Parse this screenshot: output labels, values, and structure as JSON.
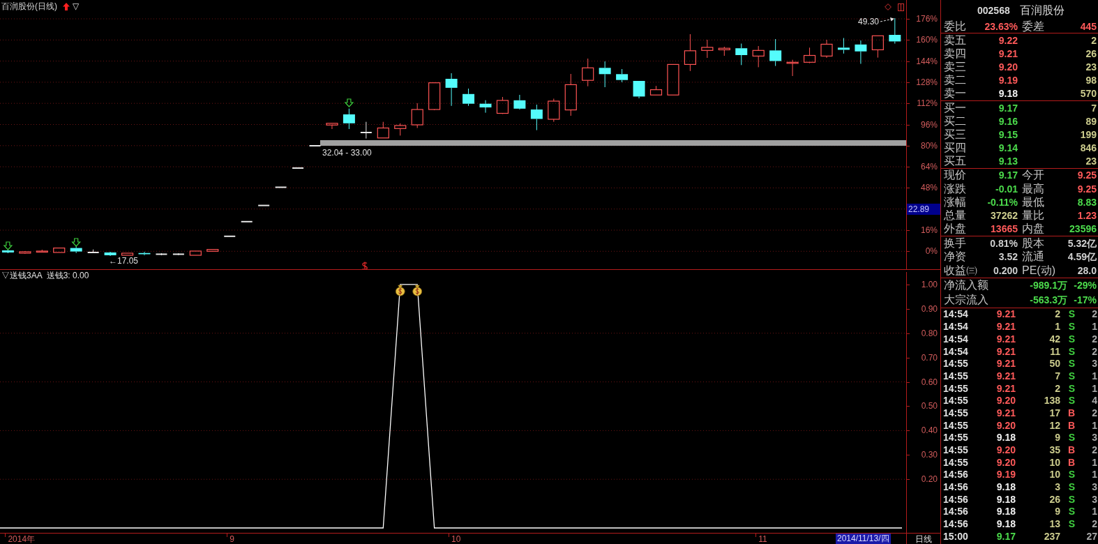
{
  "chart_header": {
    "title": "百润股份(日线)",
    "glyph": "▽"
  },
  "price_chart": {
    "axis": [
      {
        "kind": "tick",
        "label": "176%"
      },
      {
        "kind": "tick",
        "label": "160%"
      },
      {
        "kind": "tick",
        "label": "144%"
      },
      {
        "kind": "tick",
        "label": "128%"
      },
      {
        "kind": "tick",
        "label": "112%"
      },
      {
        "kind": "tick",
        "label": "96%"
      },
      {
        "kind": "tick",
        "label": "80%"
      },
      {
        "kind": "tick",
        "label": "64%"
      },
      {
        "kind": "tick",
        "label": "48%"
      },
      {
        "kind": "cursor",
        "label": "22.89"
      },
      {
        "kind": "tick",
        "label": "16%"
      },
      {
        "kind": "tick",
        "label": "0%"
      }
    ],
    "high_label": "49.30",
    "low_label": "←17.05",
    "band_label": "32.04 - 33.00"
  },
  "indicator": {
    "title": "▽送钱3AA",
    "readout": "送钱3: 0.00",
    "chart_data": {
      "type": "line",
      "ylim": [
        -0.02,
        1.06
      ],
      "grid": true,
      "yticks": [
        {
          "value": 1,
          "label": "1.00"
        },
        {
          "value": 0.9,
          "label": "0.90"
        },
        {
          "value": 0.8,
          "label": "0.80"
        },
        {
          "value": 0.7,
          "label": "0.70"
        },
        {
          "value": 0.6,
          "label": "0.60"
        },
        {
          "value": 0.5,
          "label": "0.50"
        },
        {
          "value": 0.4,
          "label": "0.40"
        },
        {
          "value": 0.3,
          "label": "0.30"
        },
        {
          "value": 0.2,
          "label": "0.20"
        }
      ],
      "series": [
        {
          "color": "#ffffff",
          "values": [
            0,
            0,
            0,
            0,
            0,
            0,
            0,
            0,
            0,
            0,
            0,
            0,
            0,
            0,
            0,
            0,
            0,
            0,
            0,
            0,
            0,
            0,
            0,
            1,
            1,
            0,
            0,
            0,
            0,
            0,
            0,
            0,
            0,
            0,
            0,
            0,
            0,
            0,
            0,
            0,
            0,
            0,
            0,
            0,
            0,
            0,
            0,
            0,
            0,
            0,
            0,
            0,
            0
          ]
        }
      ]
    }
  },
  "time_axis": {
    "labels": [
      "2014年",
      "9",
      "10",
      "11"
    ],
    "cursor_date": "2014/11/13/四",
    "period": "日线"
  },
  "quote_panel": {
    "code": "002568",
    "name": "百润股份",
    "ratio": {
      "label": "委比",
      "value": "23.63%",
      "diff_label": "委差",
      "diff_value": "445"
    },
    "asks": [
      {
        "label": "卖五",
        "price": "9.22",
        "color": "#ff5a5a",
        "volume": "2"
      },
      {
        "label": "卖四",
        "price": "9.21",
        "color": "#ff5a5a",
        "volume": "26"
      },
      {
        "label": "卖三",
        "price": "9.20",
        "color": "#ff5a5a",
        "volume": "23"
      },
      {
        "label": "卖二",
        "price": "9.19",
        "color": "#ff5a5a",
        "volume": "98"
      },
      {
        "label": "卖一",
        "price": "9.18",
        "color": "#f2f2f2",
        "volume": "570"
      }
    ],
    "bids": [
      {
        "label": "买一",
        "price": "9.17",
        "color": "#4cdc4c",
        "volume": "7"
      },
      {
        "label": "买二",
        "price": "9.16",
        "color": "#4cdc4c",
        "volume": "89"
      },
      {
        "label": "买三",
        "price": "9.15",
        "color": "#4cdc4c",
        "volume": "199"
      },
      {
        "label": "买四",
        "price": "9.14",
        "color": "#4cdc4c",
        "volume": "846"
      },
      {
        "label": "买五",
        "price": "9.13",
        "color": "#4cdc4c",
        "volume": "23"
      }
    ],
    "stats": [
      {
        "left": {
          "label": "现价",
          "value": "9.17",
          "color": "#4cdc4c"
        },
        "right": {
          "label": "今开",
          "value": "9.25",
          "color": "#ff5a5a"
        }
      },
      {
        "left": {
          "label": "涨跌",
          "value": "-0.01",
          "color": "#4cdc4c"
        },
        "right": {
          "label": "最高",
          "value": "9.25",
          "color": "#ff5a5a"
        }
      },
      {
        "left": {
          "label": "涨幅",
          "value": "-0.11%",
          "color": "#4cdc4c"
        },
        "right": {
          "label": "最低",
          "value": "8.83",
          "color": "#4cdc4c"
        }
      },
      {
        "left": {
          "label": "总量",
          "value": "37262",
          "color": "#cdcd8e"
        },
        "right": {
          "label": "量比",
          "value": "1.23",
          "color": "#ff5a5a"
        }
      },
      {
        "left": {
          "label": "外盘",
          "value": "13665",
          "color": "#ff5a5a"
        },
        "right": {
          "label": "内盘",
          "value": "23596",
          "color": "#4cdc4c"
        }
      }
    ],
    "fundamentals": [
      {
        "left": {
          "label": "换手",
          "value": "0.81%"
        },
        "right": {
          "label": "股本",
          "value": "5.32亿"
        }
      },
      {
        "left": {
          "label": "净资",
          "value": "3.52"
        },
        "right": {
          "label": "流通",
          "value": "4.59亿"
        }
      },
      {
        "left": {
          "label": "收益㈢",
          "value": "0.200"
        },
        "right": {
          "label": "PE(动)",
          "value": "28.0"
        }
      }
    ],
    "flows": [
      {
        "label": "净流入额",
        "amount": "-989.1万",
        "percent": "-29%"
      },
      {
        "label": "大宗流入",
        "amount": "-563.3万",
        "percent": "-17%"
      }
    ],
    "trades": [
      {
        "time": "14:54",
        "price": {
          "text": "9.21",
          "color": "#ff5a5a"
        },
        "volume": "2",
        "side": {
          "text": "S",
          "color": "#40d040"
        },
        "count": "2"
      },
      {
        "time": "14:54",
        "price": {
          "text": "9.21",
          "color": "#ff5a5a"
        },
        "volume": "1",
        "side": {
          "text": "S",
          "color": "#40d040"
        },
        "count": "1"
      },
      {
        "time": "14:54",
        "price": {
          "text": "9.21",
          "color": "#ff5a5a"
        },
        "volume": "42",
        "side": {
          "text": "S",
          "color": "#40d040"
        },
        "count": "2"
      },
      {
        "time": "14:54",
        "price": {
          "text": "9.21",
          "color": "#ff5a5a"
        },
        "volume": "11",
        "side": {
          "text": "S",
          "color": "#40d040"
        },
        "count": "2"
      },
      {
        "time": "14:55",
        "price": {
          "text": "9.21",
          "color": "#ff5a5a"
        },
        "volume": "50",
        "side": {
          "text": "S",
          "color": "#40d040"
        },
        "count": "3"
      },
      {
        "time": "14:55",
        "price": {
          "text": "9.21",
          "color": "#ff5a5a"
        },
        "volume": "7",
        "side": {
          "text": "S",
          "color": "#40d040"
        },
        "count": "1"
      },
      {
        "time": "14:55",
        "price": {
          "text": "9.21",
          "color": "#ff5a5a"
        },
        "volume": "2",
        "side": {
          "text": "S",
          "color": "#40d040"
        },
        "count": "1"
      },
      {
        "time": "14:55",
        "price": {
          "text": "9.20",
          "color": "#ff5a5a"
        },
        "volume": "138",
        "side": {
          "text": "S",
          "color": "#40d040"
        },
        "count": "4"
      },
      {
        "time": "14:55",
        "price": {
          "text": "9.21",
          "color": "#ff5a5a"
        },
        "volume": "17",
        "side": {
          "text": "B",
          "color": "#ff5a5a"
        },
        "count": "2"
      },
      {
        "time": "14:55",
        "price": {
          "text": "9.20",
          "color": "#ff5a5a"
        },
        "volume": "12",
        "side": {
          "text": "B",
          "color": "#ff5a5a"
        },
        "count": "1"
      },
      {
        "time": "14:55",
        "price": {
          "text": "9.18",
          "color": "#f2f2f2"
        },
        "volume": "9",
        "side": {
          "text": "S",
          "color": "#40d040"
        },
        "count": "3"
      },
      {
        "time": "14:55",
        "price": {
          "text": "9.20",
          "color": "#ff5a5a"
        },
        "volume": "35",
        "side": {
          "text": "B",
          "color": "#ff5a5a"
        },
        "count": "2"
      },
      {
        "time": "14:55",
        "price": {
          "text": "9.20",
          "color": "#ff5a5a"
        },
        "volume": "10",
        "side": {
          "text": "B",
          "color": "#ff5a5a"
        },
        "count": "1"
      },
      {
        "time": "14:56",
        "price": {
          "text": "9.19",
          "color": "#ff5a5a"
        },
        "volume": "10",
        "side": {
          "text": "S",
          "color": "#40d040"
        },
        "count": "1"
      },
      {
        "time": "14:56",
        "price": {
          "text": "9.18",
          "color": "#f2f2f2"
        },
        "volume": "3",
        "side": {
          "text": "S",
          "color": "#40d040"
        },
        "count": "3"
      },
      {
        "time": "14:56",
        "price": {
          "text": "9.18",
          "color": "#f2f2f2"
        },
        "volume": "26",
        "side": {
          "text": "S",
          "color": "#40d040"
        },
        "count": "3"
      },
      {
        "time": "14:56",
        "price": {
          "text": "9.18",
          "color": "#f2f2f2"
        },
        "volume": "9",
        "side": {
          "text": "S",
          "color": "#40d040"
        },
        "count": "1"
      },
      {
        "time": "14:56",
        "price": {
          "text": "9.18",
          "color": "#f2f2f2"
        },
        "volume": "13",
        "side": {
          "text": "S",
          "color": "#40d040"
        },
        "count": "2"
      },
      {
        "time": "15:00",
        "price": {
          "text": "9.17",
          "color": "#4cdc4c"
        },
        "volume": "237",
        "count": "27"
      }
    ]
  }
}
